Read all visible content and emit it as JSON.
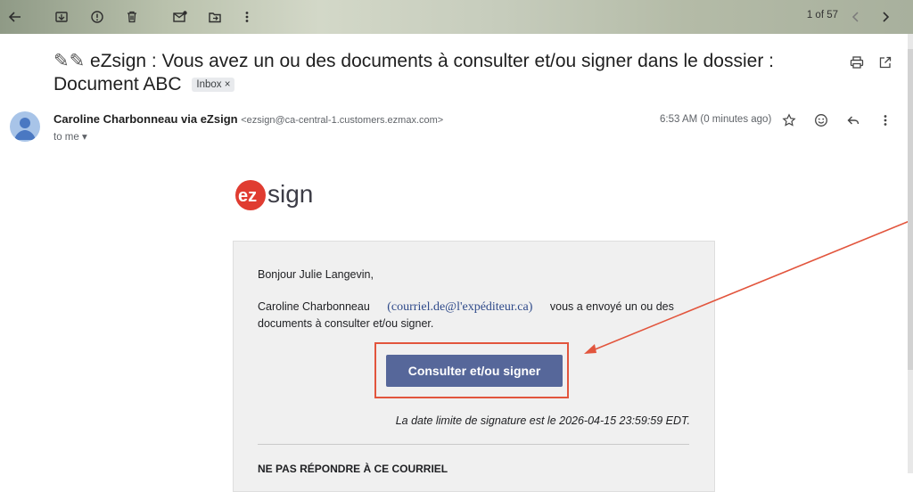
{
  "toolbar": {
    "icons": [
      "back-arrow-icon",
      "archive-icon",
      "report-spam-icon",
      "delete-icon",
      "mark-unread-icon",
      "move-to-icon",
      "more-vert-icon"
    ],
    "pager": "1 of 57"
  },
  "email": {
    "subject_prefix": "✎✎",
    "subject": "eZsign : Vous avez un ou des documents à consulter et/ou signer dans le dossier : Document ABC",
    "label": "Inbox",
    "sender_name": "Caroline Charbonneau via eZsign",
    "sender_address": "<ezsign@ca-central-1.customers.ezmax.com>",
    "recipient": "to me",
    "time": "6:53 AM (0 minutes ago)"
  },
  "body": {
    "logo_text": "ezsign",
    "greeting": "Bonjour Julie Langevin,",
    "sender": "Caroline Charbonneau",
    "sender_email": "(courriel.de@l'expéditeur.ca)",
    "message": "vous a envoyé un ou des documents à consulter et/ou signer.",
    "cta_label": "Consulter et/ou signer",
    "deadline": "La date limite de signature est le 2026-04-15 23:59:59 EDT.",
    "noreply": "NE PAS RÉPONDRE À CE COURRIEL"
  },
  "colors": {
    "accent": "#56679a",
    "annotation": "#e2553d",
    "logo_red": "#e03c31",
    "logo_dark": "#3c3c46"
  }
}
